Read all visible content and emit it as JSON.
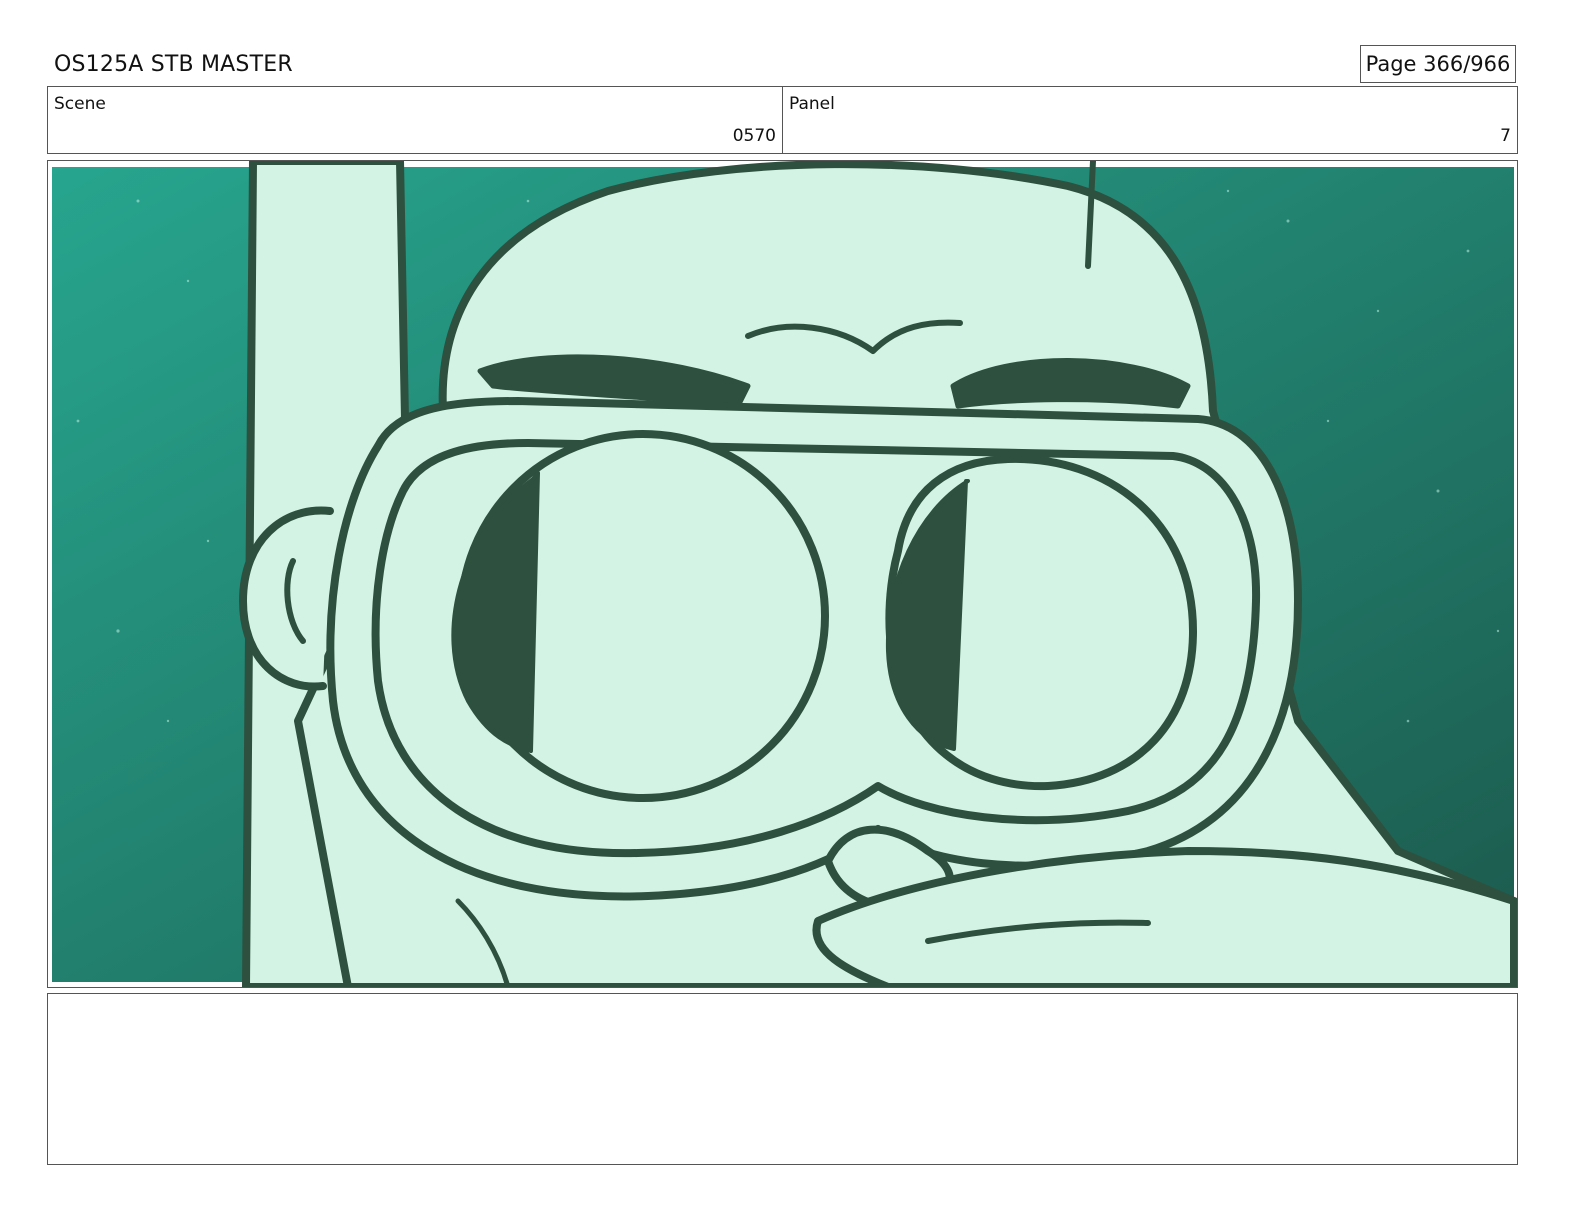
{
  "header": {
    "title": "OS125A STB MASTER",
    "page_label": "Page 366/966"
  },
  "info": {
    "scene_label": "Scene",
    "scene_value": "0570",
    "panel_label": "Panel",
    "panel_value": "7"
  },
  "artwork": {
    "subject": "storyboard drawing of a character in a diving mask and snorkel underwater",
    "colors": {
      "water_light": "#27a58e",
      "water_dark": "#1c5a4d",
      "fill": "#d3f4e4",
      "line": "#2e503f"
    }
  },
  "notes": {
    "text": ""
  }
}
